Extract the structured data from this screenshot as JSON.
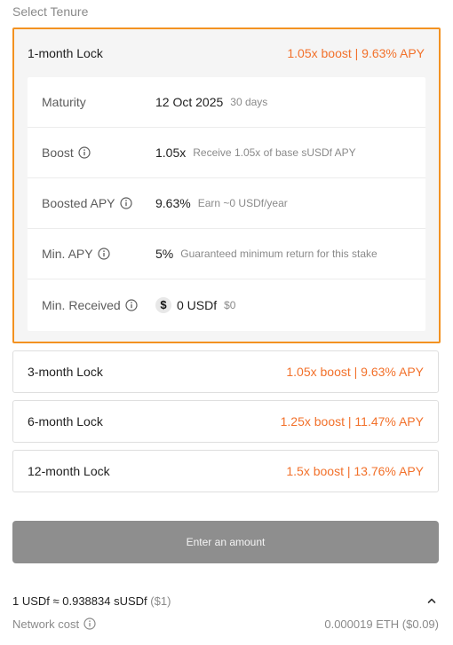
{
  "section_label": "Select Tenure",
  "selected_lock": {
    "name": "1-month Lock",
    "boost_text": "1.05x boost | 9.63% APY",
    "details": {
      "maturity": {
        "label": "Maturity",
        "value": "12 Oct 2025",
        "note": "30 days"
      },
      "boost": {
        "label": "Boost",
        "value": "1.05x",
        "note": "Receive 1.05x of base sUSDf APY"
      },
      "boosted_apy": {
        "label": "Boosted APY",
        "value": "9.63%",
        "note": "Earn ~0 USDf/year"
      },
      "min_apy": {
        "label": "Min. APY",
        "value": "5%",
        "note": "Guaranteed minimum return for this stake"
      },
      "min_received": {
        "label": "Min. Received",
        "coin_symbol": "$",
        "value": "0 USDf",
        "note": "$0"
      }
    }
  },
  "locks": [
    {
      "name": "3-month Lock",
      "boost_text": "1.05x boost | 9.63% APY"
    },
    {
      "name": "6-month Lock",
      "boost_text": "1.25x boost | 11.47% APY"
    },
    {
      "name": "12-month Lock",
      "boost_text": "1.5x boost | 13.76% APY"
    }
  ],
  "cta_label": "Enter an amount",
  "rate": {
    "text": "1 USDf ≈ 0.938834 sUSDf",
    "usd": "($1)"
  },
  "network_cost": {
    "label": "Network cost",
    "value": "0.000019 ETH ($0.09)"
  },
  "colors": {
    "accent": "#f39221",
    "boost_text": "#f2712b",
    "cta_bg": "#8e8e8e"
  }
}
